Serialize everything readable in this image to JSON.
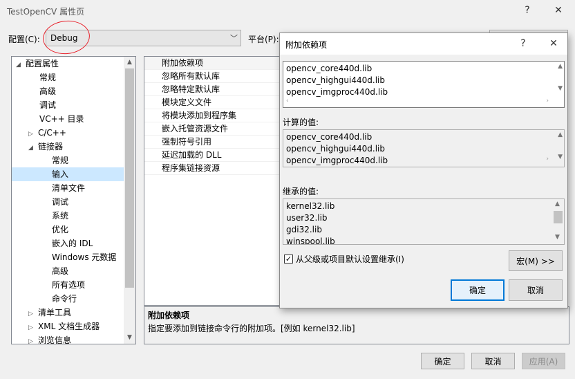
{
  "window": {
    "title": "TestOpenCV 属性页",
    "help_glyph": "?",
    "close_glyph": "✕"
  },
  "config": {
    "label": "配置(C):",
    "value": "Debug",
    "platform_label": "平台(P):"
  },
  "tree": {
    "items": [
      {
        "label": "配置属性",
        "exp": "◢"
      },
      {
        "label": "常规"
      },
      {
        "label": "高级"
      },
      {
        "label": "调试"
      },
      {
        "label": "VC++ 目录"
      },
      {
        "label": "C/C++",
        "exp": "▷"
      },
      {
        "label": "链接器",
        "exp": "◢"
      },
      {
        "label": "常规"
      },
      {
        "label": "输入"
      },
      {
        "label": "清单文件"
      },
      {
        "label": "调试"
      },
      {
        "label": "系统"
      },
      {
        "label": "优化"
      },
      {
        "label": "嵌入的 IDL"
      },
      {
        "label": "Windows 元数据"
      },
      {
        "label": "高级"
      },
      {
        "label": "所有选项"
      },
      {
        "label": "命令行"
      },
      {
        "label": "清单工具",
        "exp": "▷"
      },
      {
        "label": "XML 文档生成器",
        "exp": "▷"
      },
      {
        "label": "浏览信息",
        "exp": "▷"
      }
    ]
  },
  "props": {
    "rows": [
      "附加依赖项",
      "忽略所有默认库",
      "忽略特定默认库",
      "模块定义文件",
      "将模块添加到程序集",
      "嵌入托管资源文件",
      "强制符号引用",
      "延迟加载的 DLL",
      "程序集链接资源"
    ]
  },
  "description": {
    "title": "附加依赖项",
    "text": "指定要添加到链接命令行的附加项。[例如 kernel32.lib]"
  },
  "bottom_buttons": {
    "ok": "确定",
    "cancel": "取消",
    "apply": "应用(A)"
  },
  "dialog": {
    "title": "附加依赖项",
    "help_glyph": "?",
    "close_glyph": "✕",
    "edit_lines": [
      "opencv_core440d.lib",
      "opencv_highgui440d.lib",
      "opencv_imgproc440d.lib"
    ],
    "computed_label": "计算的值:",
    "computed_lines": [
      "opencv_core440d.lib",
      "opencv_highgui440d.lib",
      "opencv_imgproc440d.lib"
    ],
    "inherited_label": "继承的值:",
    "inherited_lines": [
      "kernel32.lib",
      "user32.lib",
      "gdi32.lib",
      "winspool.lib"
    ],
    "inherit_checkbox": "从父级或项目默认设置继承(I)",
    "inherit_checked": true,
    "macro_button": "宏(M) >>",
    "ok": "确定",
    "cancel": "取消"
  }
}
